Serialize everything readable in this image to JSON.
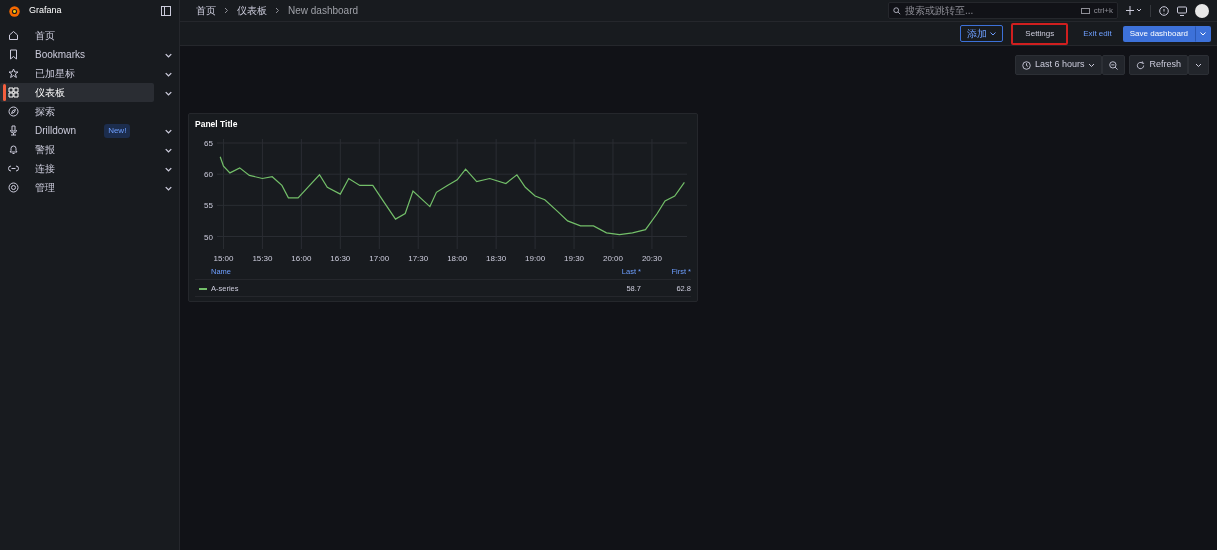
{
  "brand": "Grafana",
  "sidebar": {
    "items": [
      {
        "label": "首页",
        "selected": false,
        "expandable": false
      },
      {
        "label": "Bookmarks",
        "selected": false,
        "expandable": true
      },
      {
        "label": "已加星标",
        "selected": false,
        "expandable": true
      },
      {
        "label": "仪表板",
        "selected": true,
        "expandable": true
      },
      {
        "label": "探索",
        "selected": false,
        "expandable": false
      },
      {
        "label": "Drilldown",
        "selected": false,
        "expandable": true,
        "badge": "New!"
      },
      {
        "label": "警报",
        "selected": false,
        "expandable": true
      },
      {
        "label": "连接",
        "selected": false,
        "expandable": true
      },
      {
        "label": "管理",
        "selected": false,
        "expandable": true
      }
    ]
  },
  "breadcrumbs": [
    "首页",
    "仪表板",
    "New dashboard"
  ],
  "search": {
    "placeholder": "搜索或跳转至...",
    "shortcut": "ctrl+k"
  },
  "toolbar": {
    "add": "添加",
    "settings": {
      "label": "Settings",
      "highlighted": true
    },
    "exit": "Exit edit",
    "save": "Save dashboard"
  },
  "time_range": "Last 6 hours",
  "refresh": "Refresh",
  "panel": {
    "title": "Panel Title",
    "chart_data": {
      "type": "line",
      "x": [
        14.958,
        15,
        15.083,
        15.208,
        15.333,
        15.5,
        15.625,
        15.75,
        15.833,
        15.958,
        16.083,
        16.233,
        16.333,
        16.5,
        16.608,
        16.75,
        16.917,
        17.067,
        17.208,
        17.333,
        17.433,
        17.65,
        17.733,
        17.875,
        18,
        18.108,
        18.25,
        18.417,
        18.625,
        18.767,
        18.875,
        19,
        19.125,
        19.292,
        19.417,
        19.583,
        19.75,
        19.917,
        20.083,
        20.25,
        20.417,
        20.567,
        20.667,
        20.792,
        20.917
      ],
      "xlim": [
        14.917,
        20.95
      ],
      "series": [
        {
          "name": "A-series",
          "color": "#73bf69",
          "values": [
            62.8,
            61.3,
            60.2,
            61.0,
            59.8,
            59.3,
            59.6,
            58.2,
            56.2,
            56.2,
            57.9,
            59.9,
            57.9,
            56.8,
            59.3,
            58.2,
            58.2,
            55.4,
            52.8,
            53.7,
            57.3,
            54.8,
            57.1,
            58.2,
            59.1,
            60.8,
            58.8,
            59.3,
            58.5,
            59.9,
            57.9,
            56.5,
            55.9,
            54.0,
            52.5,
            51.7,
            51.7,
            50.6,
            50.3,
            50.6,
            51.1,
            53.7,
            55.7,
            56.5,
            58.7
          ]
        }
      ],
      "grid": true,
      "ylim": [
        48,
        65
      ],
      "yticks": [
        50,
        55,
        60,
        65
      ],
      "xticks": [
        {
          "value": 15,
          "label": "15:00"
        },
        {
          "value": 15.5,
          "label": "15:30"
        },
        {
          "value": 16,
          "label": "16:00"
        },
        {
          "value": 16.5,
          "label": "16:30"
        },
        {
          "value": 17,
          "label": "17:00"
        },
        {
          "value": 17.5,
          "label": "17:30"
        },
        {
          "value": 18,
          "label": "18:00"
        },
        {
          "value": 18.5,
          "label": "18:30"
        },
        {
          "value": 19,
          "label": "19:00"
        },
        {
          "value": 19.5,
          "label": "19:30"
        },
        {
          "value": 20,
          "label": "20:00"
        },
        {
          "value": 20.5,
          "label": "20:30"
        }
      ]
    },
    "legend": {
      "columns": [
        "Name",
        "Last *",
        "First *"
      ],
      "rows": [
        {
          "last": "58.7",
          "first": "62.8"
        }
      ]
    }
  }
}
